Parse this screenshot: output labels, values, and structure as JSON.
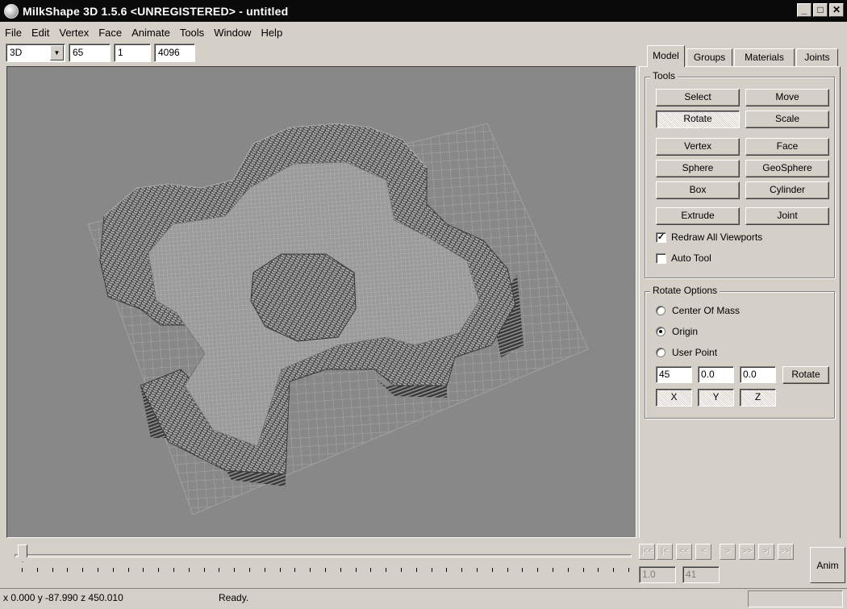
{
  "window": {
    "title": "MilkShape 3D 1.5.6 <UNREGISTERED> - untitled",
    "controls": [
      "_",
      " ̸",
      "x"
    ]
  },
  "menu": [
    "File",
    "Edit",
    "Vertex",
    "Face",
    "Animate",
    "Tools",
    "Window",
    "Help"
  ],
  "toolbar": {
    "view_mode": "3D",
    "field1": "65",
    "field2": "1",
    "field3": "4096"
  },
  "tabs": [
    "Model",
    "Groups",
    "Materials",
    "Joints"
  ],
  "tools": {
    "title": "Tools",
    "buttons": [
      "Select",
      "Move",
      "Rotate",
      "Scale",
      "Vertex",
      "Face",
      "Sphere",
      "GeoSphere",
      "Box",
      "Cylinder",
      "Extrude",
      "Joint"
    ],
    "active_tool": "Rotate",
    "redraw_label": "Redraw All Viewports",
    "redraw_checked": true,
    "autotool_label": "Auto Tool",
    "autotool_checked": false
  },
  "rotate_options": {
    "title": "Rotate Options",
    "center_of_mass": "Center Of Mass",
    "origin": "Origin",
    "user_point": "User Point",
    "selected": "Origin",
    "angle": "45",
    "v1": "0.0",
    "v2": "0.0",
    "rotate_label": "Rotate",
    "x_label": "X",
    "y_label": "Y",
    "z_label": "Z"
  },
  "animation": {
    "playback": [
      "|<<",
      "|<",
      "<<",
      "<",
      ">",
      ">>",
      ">|",
      ">>|"
    ],
    "frame": "1.0",
    "total": "41",
    "anim_label": "Anim"
  },
  "status": {
    "coords": "x 0.000 y -87.990 z 450.010",
    "message": "Ready."
  },
  "colors": {
    "titlebar": "#0a0a0a",
    "chrome": "#d4d0c8",
    "viewport_bg": "#888888",
    "grid": "#a8a8a8"
  }
}
